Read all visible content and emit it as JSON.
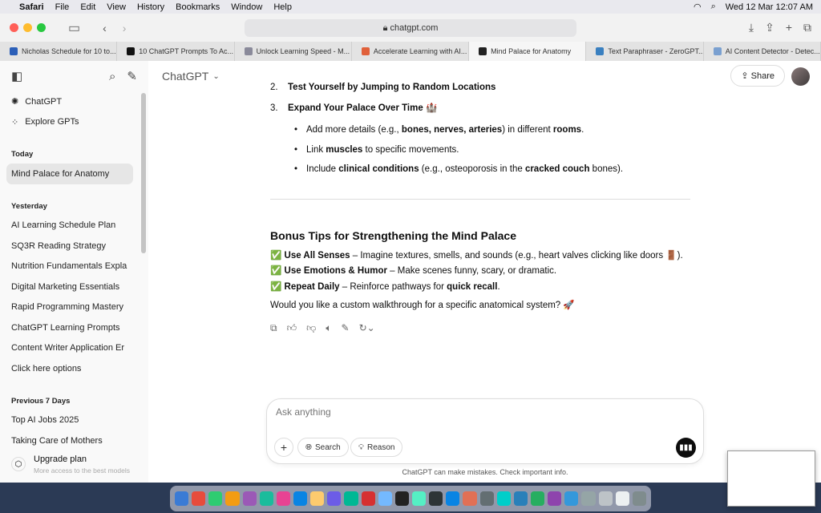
{
  "menubar": {
    "app": "Safari",
    "items": [
      "File",
      "Edit",
      "View",
      "History",
      "Bookmarks",
      "Window",
      "Help"
    ],
    "datetime": "Wed 12 Mar  12:07 AM"
  },
  "browser": {
    "url": "chatgpt.com",
    "tabs": [
      {
        "label": "Nicholas Schedule for 10 to...",
        "color": "#2b5fb8"
      },
      {
        "label": "10 ChatGPT Prompts To Ac...",
        "color": "#111111"
      },
      {
        "label": "Unlock Learning Speed - M...",
        "color": "#8a8a9a"
      },
      {
        "label": "Accelerate Learning with AI...",
        "color": "#e0603a"
      },
      {
        "label": "Mind Palace for Anatomy",
        "color": "#222222"
      },
      {
        "label": "Text Paraphraser - ZeroGPT...",
        "color": "#3a80c0"
      },
      {
        "label": "AI Content Detector - Detec...",
        "color": "#7aa0d0"
      }
    ],
    "active_tab": 4
  },
  "sidebar": {
    "top": [
      {
        "label": "ChatGPT",
        "icon": "openai-icon"
      },
      {
        "label": "Explore GPTs",
        "icon": "grid-icon"
      }
    ],
    "sections": [
      {
        "title": "Today",
        "items": [
          "Mind Palace for Anatomy"
        ]
      },
      {
        "title": "Yesterday",
        "items": [
          "AI Learning Schedule Plan",
          "SQ3R Reading Strategy",
          "Nutrition Fundamentals Expla",
          "Digital Marketing Essentials",
          "Rapid Programming Mastery",
          "ChatGPT Learning Prompts",
          "Content Writer Application Er",
          "Click here options"
        ]
      },
      {
        "title": "Previous 7 Days",
        "items": [
          "Top AI Jobs 2025",
          "Taking Care of Mothers"
        ]
      }
    ],
    "upgrade": {
      "title": "Upgrade plan",
      "subtitle": "More access to the best models"
    }
  },
  "header": {
    "model": "ChatGPT",
    "share": "Share"
  },
  "message": {
    "step2": {
      "n": "2.",
      "text": "Test Yourself by Jumping to Random Locations"
    },
    "step3": {
      "n": "3.",
      "text": "Expand Your Palace Over Time 🏰"
    },
    "bullets": [
      [
        "Add more details (e.g., ",
        "bones, nerves, arteries",
        ") in different ",
        "rooms",
        "."
      ],
      [
        "Link ",
        "muscles",
        " to specific movements."
      ],
      [
        "Include ",
        "clinical conditions",
        " (e.g., osteoporosis in the ",
        "cracked couch",
        " bones)."
      ]
    ],
    "heading": "Bonus Tips for Strengthening the Mind Palace",
    "tips": [
      {
        "check": "✅",
        "bold": "Use All Senses",
        "text": " – Imagine textures, smells, and sounds (e.g., heart valves clicking like doors 🚪)."
      },
      {
        "check": "✅",
        "bold": "Use Emotions & Humor",
        "text": " – Make scenes funny, scary, or dramatic."
      },
      {
        "check": "✅",
        "bold": "Repeat Daily",
        "text": " – Reinforce pathways for ",
        "bold2": "quick recall",
        "end": "."
      }
    ],
    "closing": "Would you like a custom walkthrough for a specific anatomical system? 🚀"
  },
  "composer": {
    "placeholder": "Ask anything",
    "search": "Search",
    "reason": "Reason",
    "disclaimer": "ChatGPT can make mistakes. Check important info."
  }
}
